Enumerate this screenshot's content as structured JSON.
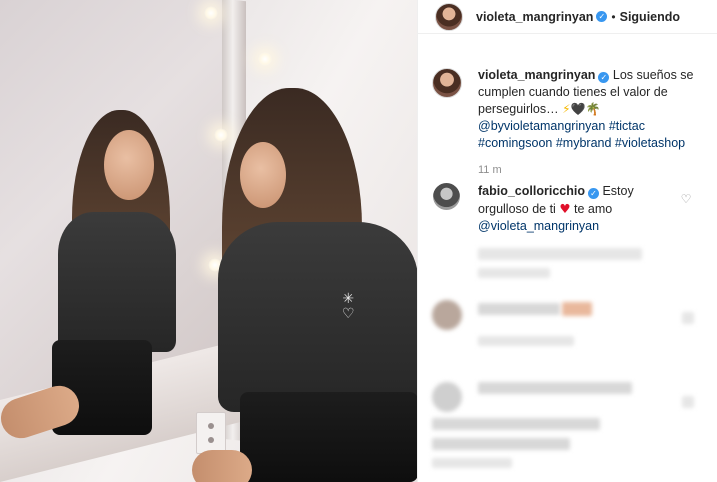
{
  "header": {
    "username": "violeta_mangrinyan",
    "separator": "•",
    "follow_status": "Siguiendo"
  },
  "caption": {
    "username": "violeta_mangrinyan",
    "text": "Los sueños se cumplen cuando tienes el valor de perseguirlos…",
    "emojis": [
      "⚡",
      "🖤",
      "🌴"
    ],
    "mention": "@byvioletamangrinyan",
    "hashtags": [
      "#tictac",
      "#comingsoon",
      "#mybrand",
      "#violetashop"
    ]
  },
  "timestamp": "11 m",
  "comment": {
    "username": "fabio_colloricchio",
    "text_before": "Estoy orgulloso de ti",
    "heart": "♥",
    "text_after": "te amo",
    "mention": "@violeta_mangrinyan"
  },
  "shirt_print": {
    "symbol_top": "✳",
    "symbol_bottom": "♡"
  },
  "colors": {
    "verified": "#3897f0",
    "link": "#003569",
    "muted": "#8e8e8e",
    "heart": "#e0102a"
  },
  "icons": {
    "verified": "verified-badge-icon",
    "like": "heart-outline-icon"
  }
}
